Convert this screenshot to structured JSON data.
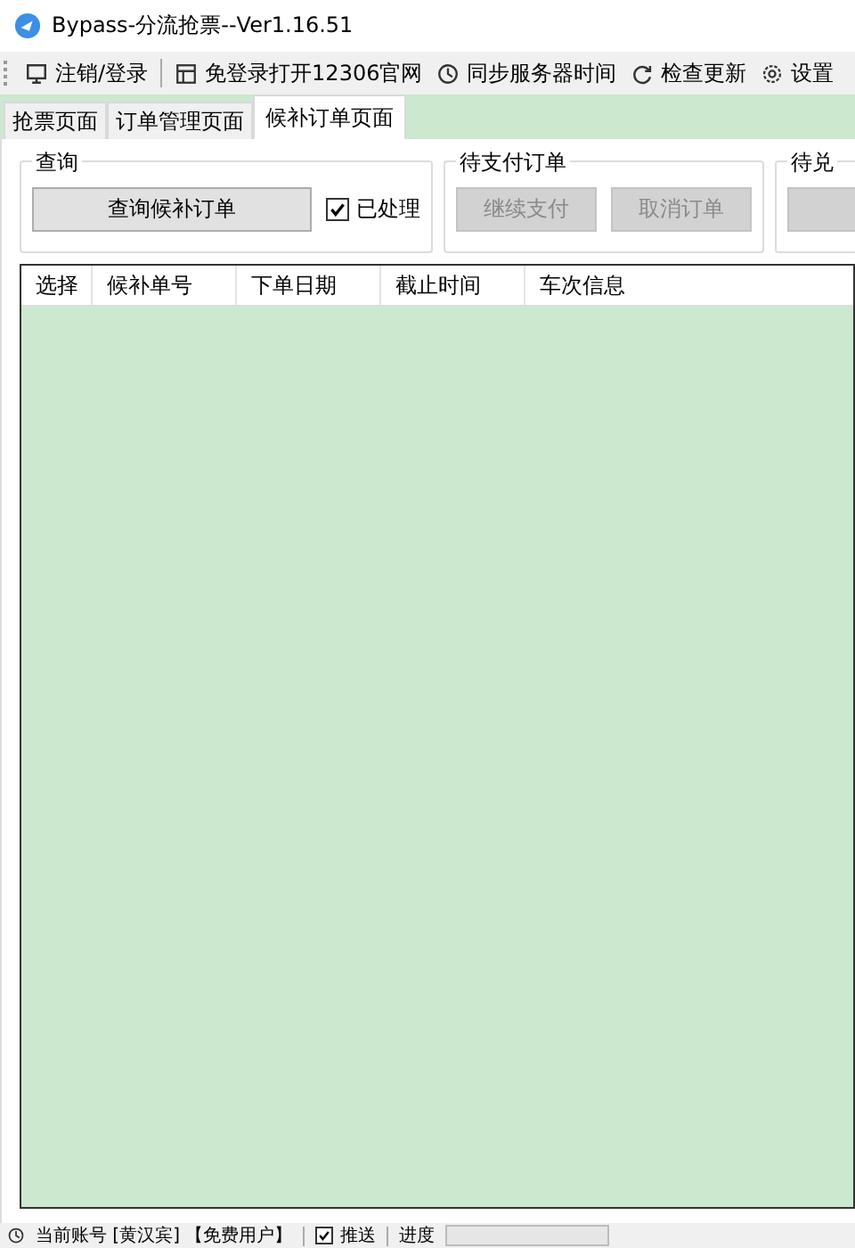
{
  "window": {
    "title": "Bypass-分流抢票--Ver1.16.51"
  },
  "toolbar": [
    {
      "kind": "monitor",
      "label": "注销/登录"
    },
    {
      "kind": "window",
      "label": "免登录打开12306官网"
    },
    {
      "kind": "clock",
      "label": "同步服务器时间"
    },
    {
      "kind": "refresh",
      "label": "检查更新"
    },
    {
      "kind": "gear",
      "label": "设置"
    }
  ],
  "tabs": [
    {
      "label": "抢票页面",
      "selected": false
    },
    {
      "label": "订单管理页面",
      "selected": false
    },
    {
      "label": "候补订单页面",
      "selected": true
    }
  ],
  "groups": [
    {
      "title": "查询",
      "buttons": [
        {
          "label": "查询候补订单",
          "disabled": false
        }
      ],
      "checkbox": {
        "label": "已处理",
        "checked": true
      }
    },
    {
      "title": "待支付订单",
      "buttons": [
        {
          "label": "继续支付",
          "disabled": true
        },
        {
          "label": "取消订单",
          "disabled": true
        }
      ]
    },
    {
      "title": "待兑",
      "buttons": [
        {
          "disabled": true
        }
      ]
    }
  ],
  "table": {
    "columns": [
      "选择",
      "候补单号",
      "下单日期",
      "截止时间",
      "车次信息"
    ]
  },
  "status_bar": {
    "account": "当前账号 [黄汉宾] 【免费用户】",
    "push": {
      "label": "推送",
      "checked": true
    },
    "progress": {
      "label": "进度",
      "level": 0
    }
  }
}
